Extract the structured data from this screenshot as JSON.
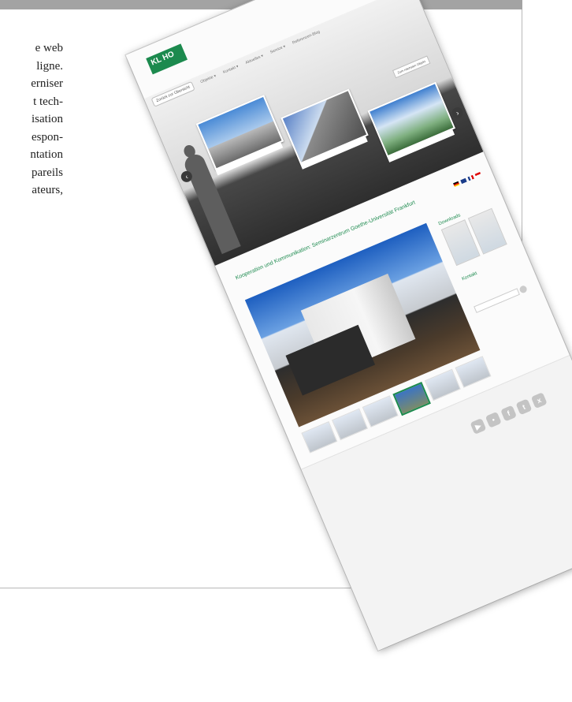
{
  "article": {
    "lines": [
      "e web",
      "ligne.",
      "erniser",
      "t tech-",
      "isation",
      "espon-",
      "ntation",
      "pareils",
      "ateurs,"
    ]
  },
  "site": {
    "brand": "KL HO",
    "nav": [
      "Objekte ▾",
      "Kontakt ▾",
      "Aktuelles ▾",
      "Service ▾",
      "Referenzen-Blog"
    ],
    "back_label": "Zurück zur Übersicht",
    "next_label": "Zum nächsten Objekt",
    "title": "Kooperation und Kommunikation: Seminarzentrum Goethe-Universität Frankfurt",
    "sidebar_downloads": "Downloads",
    "sidebar_kontakt": "Kontakt"
  },
  "social_icons": [
    "youtube-icon",
    "flickr-icon",
    "facebook-icon",
    "twitter-icon",
    "xing-icon"
  ],
  "colors": {
    "brand_green": "#1c8a4e",
    "frame_gray": "#a3a3a3",
    "hero_dark": "#2e2e2e"
  }
}
